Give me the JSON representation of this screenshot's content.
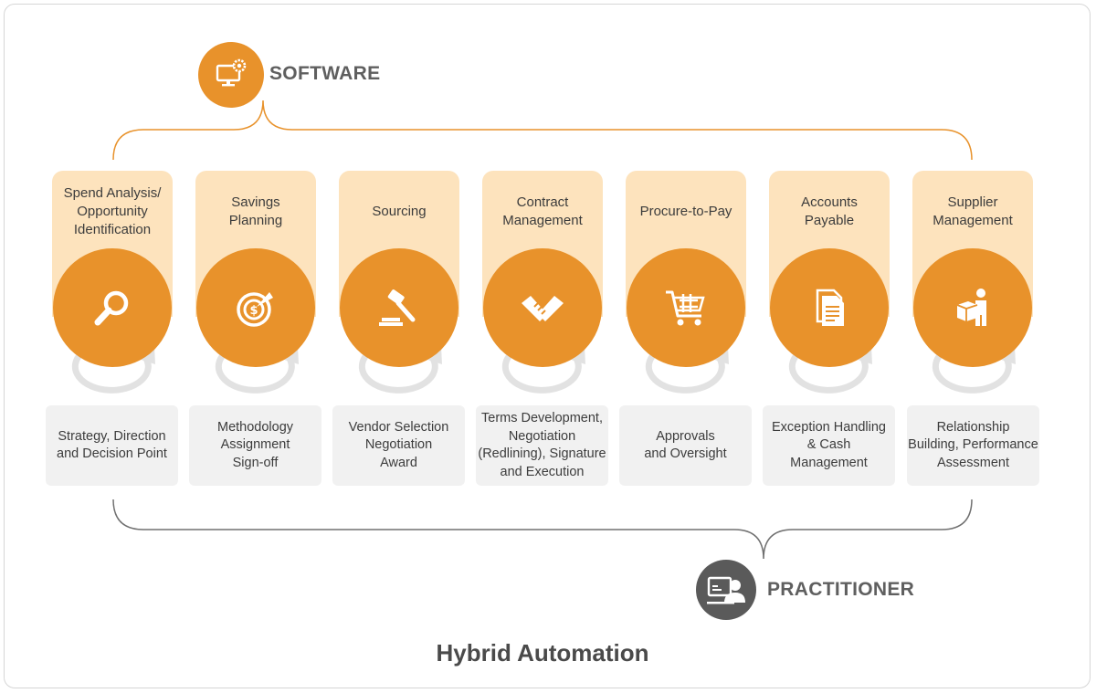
{
  "software": {
    "label": "SOFTWARE",
    "color": "#e8922b",
    "icon": "computer-gear-icon"
  },
  "practitioner": {
    "label": "PRACTITIONER",
    "color": "#5a5a5a",
    "icon": "presenter-screen-icon"
  },
  "title": "Hybrid Automation",
  "steps": [
    {
      "label": "Spend Analysis/\nOpportunity\nIdentification",
      "icon": "magnifier-icon",
      "practitioner_task": "Strategy, Direction\nand Decision Point"
    },
    {
      "label": "Savings\nPlanning",
      "icon": "target-icon",
      "practitioner_task": "Methodology\nAssignment\nSign-off"
    },
    {
      "label": "Sourcing",
      "icon": "gavel-icon",
      "practitioner_task": "Vendor Selection\nNegotiation\nAward"
    },
    {
      "label": "Contract\nManagement",
      "icon": "handshake-icon",
      "practitioner_task": "Terms Development,\nNegotiation\n(Redlining), Signature\nand Execution"
    },
    {
      "label": "Procure-to-Pay",
      "icon": "shopping-cart-icon",
      "practitioner_task": "Approvals\nand Oversight"
    },
    {
      "label": "Accounts\nPayable",
      "icon": "documents-icon",
      "practitioner_task": "Exception Handling\n& Cash\nManagement"
    },
    {
      "label": "Supplier\nManagement",
      "icon": "person-box-icon",
      "practitioner_task": "Relationship\nBuilding, Performance\nAssessment"
    }
  ]
}
